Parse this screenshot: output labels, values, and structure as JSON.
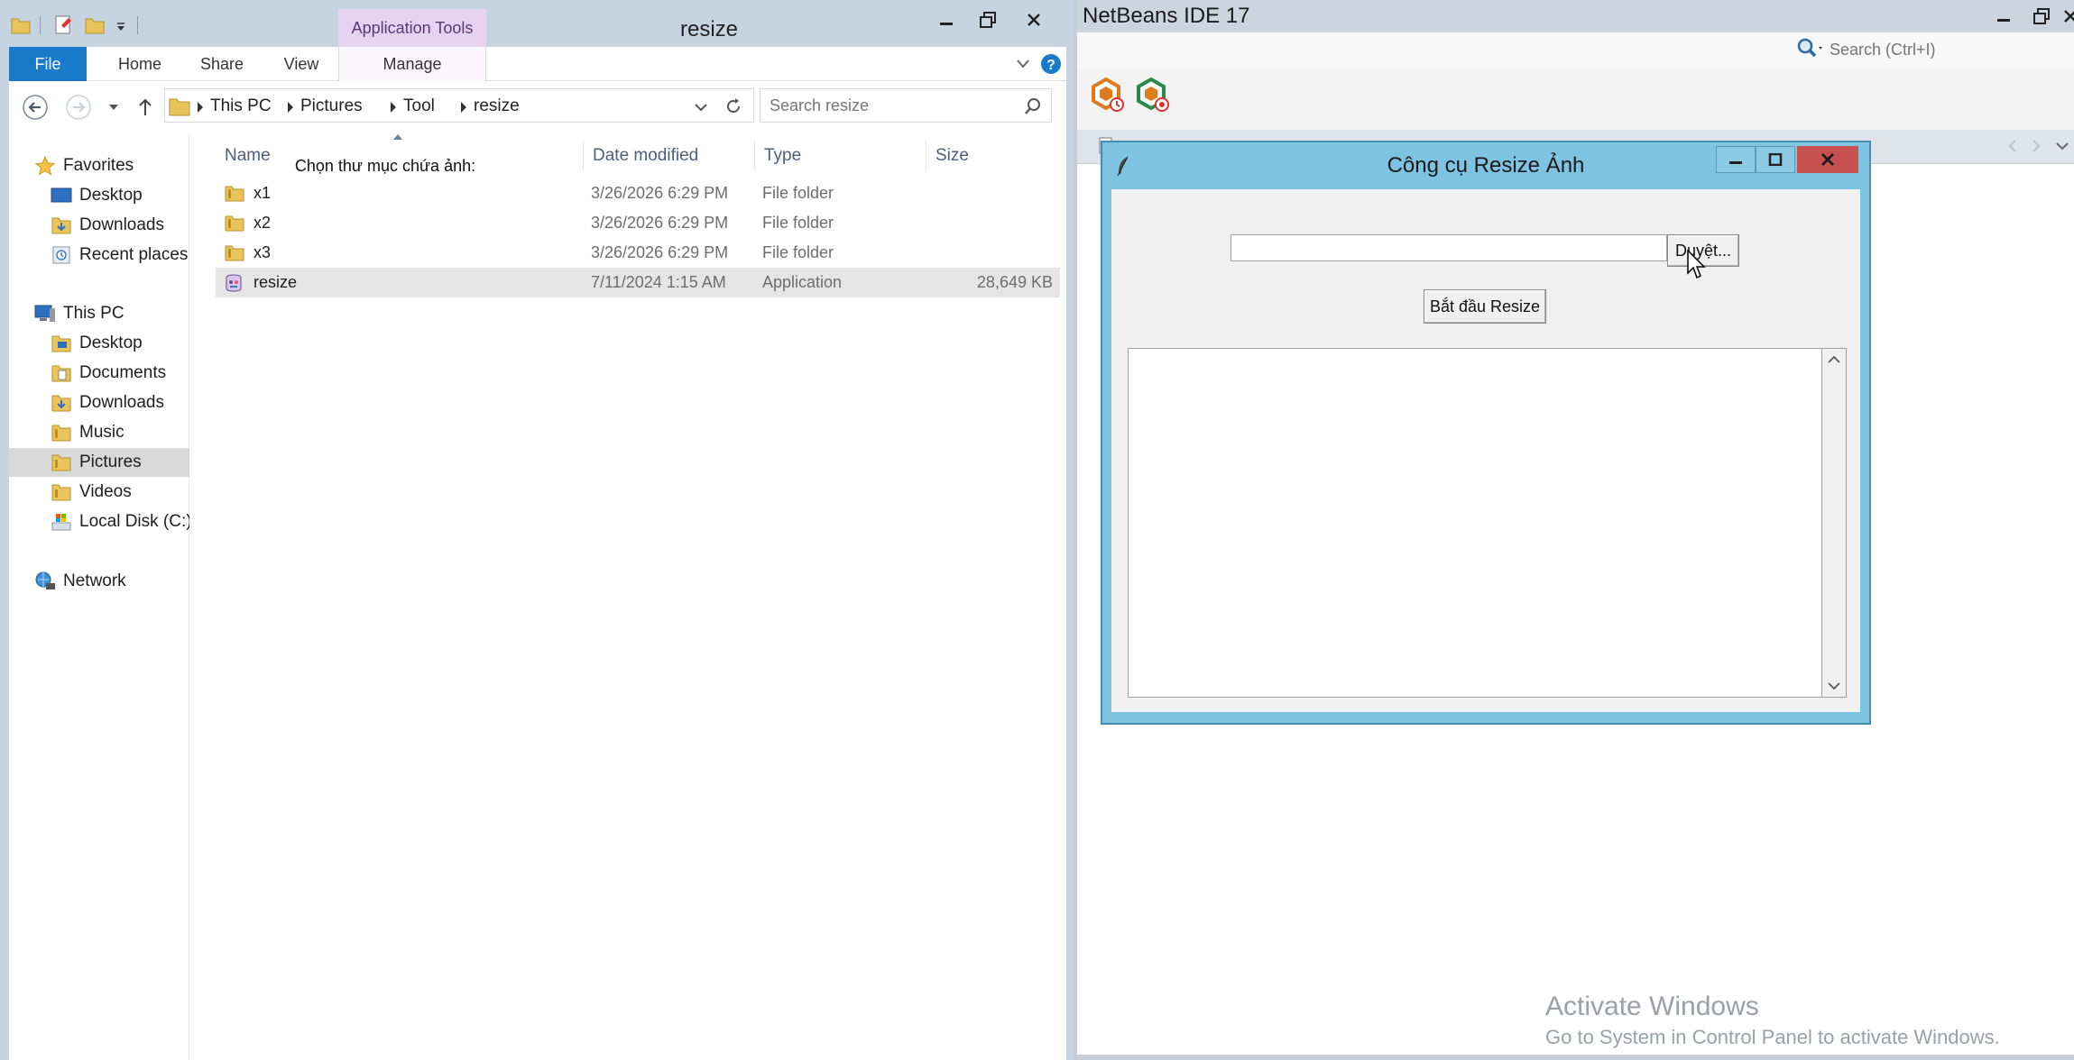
{
  "netbeans": {
    "title": "NetBeans IDE 17",
    "search_placeholder": "Search (Ctrl+I)"
  },
  "explorer": {
    "title": "resize",
    "contextual_tab": "Application Tools",
    "ribbon_tabs": [
      "File",
      "Home",
      "Share",
      "View",
      "Manage"
    ],
    "breadcrumb": [
      "This PC",
      "Pictures",
      "Tool",
      "resize"
    ],
    "search_placeholder": "Search resize",
    "nav": {
      "favorites": "Favorites",
      "favorites_items": [
        "Desktop",
        "Downloads",
        "Recent places"
      ],
      "this_pc": "This PC",
      "this_pc_items": [
        "Desktop",
        "Documents",
        "Downloads",
        "Music",
        "Pictures",
        "Videos",
        "Local Disk (C:)"
      ],
      "network": "Network",
      "selected": "Pictures"
    },
    "columns": [
      "Name",
      "Date modified",
      "Type",
      "Size"
    ],
    "files": [
      {
        "name": "x1",
        "date": "3/26/2026 6:29 PM",
        "type": "File folder",
        "size": ""
      },
      {
        "name": "x2",
        "date": "3/26/2026 6:29 PM",
        "type": "File folder",
        "size": ""
      },
      {
        "name": "x3",
        "date": "3/26/2026 6:29 PM",
        "type": "File folder",
        "size": ""
      },
      {
        "name": "resize",
        "date": "7/11/2024 1:15 AM",
        "type": "Application",
        "size": "28,649 KB"
      }
    ]
  },
  "dialog": {
    "title": "Công cụ Resize Ảnh",
    "label": "Chọn thư mục chứa ảnh:",
    "path_value": "",
    "browse_button": "Duyệt...",
    "start_button": "Bắt đầu Resize"
  },
  "watermark": {
    "line1": "Activate Windows",
    "line2": "Go to System in Control Panel to activate Windows."
  },
  "colors": {
    "file_tab": "#1979ca",
    "contextual_tab": "#e6d3f1",
    "dialog_frame": "#7ec4e2",
    "dialog_close": "#c75050"
  }
}
